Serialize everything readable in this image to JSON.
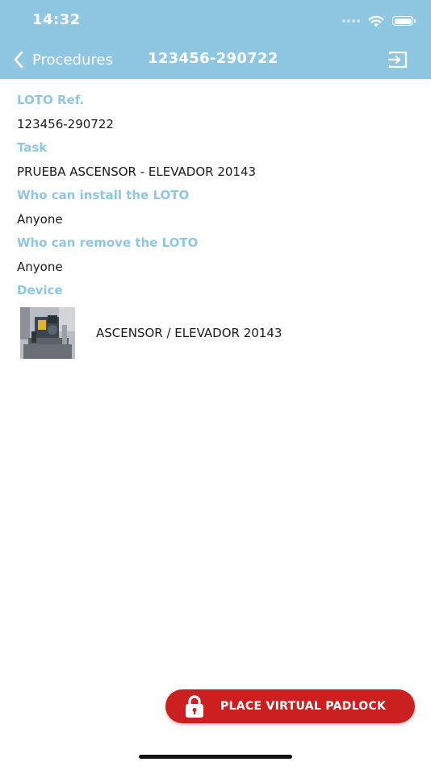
{
  "status_bar": {
    "time": "14:32"
  },
  "nav": {
    "back_label": "Procedures",
    "title": "123456-290722"
  },
  "fields": [
    {
      "label": "LOTO Ref.",
      "value": "123456-290722"
    },
    {
      "label": "Task",
      "value": "PRUEBA ASCENSOR - ELEVADOR 20143"
    },
    {
      "label": "Who can install the LOTO",
      "value": "Anyone"
    },
    {
      "label": "Who can remove the LOTO",
      "value": "Anyone"
    }
  ],
  "device": {
    "label": "Device",
    "name": "ASCENSOR / ELEVADOR 20143"
  },
  "action_button": {
    "label": "PLACE VIRTUAL PADLOCK"
  },
  "colors": {
    "header": "#8fc6e1",
    "label": "#8fc6e1",
    "button": "#cc1f1f"
  },
  "icons": {
    "back": "chevron-left-icon",
    "exit": "exit-icon",
    "padlock": "padlock-icon",
    "wifi": "wifi-icon",
    "battery": "battery-icon"
  }
}
